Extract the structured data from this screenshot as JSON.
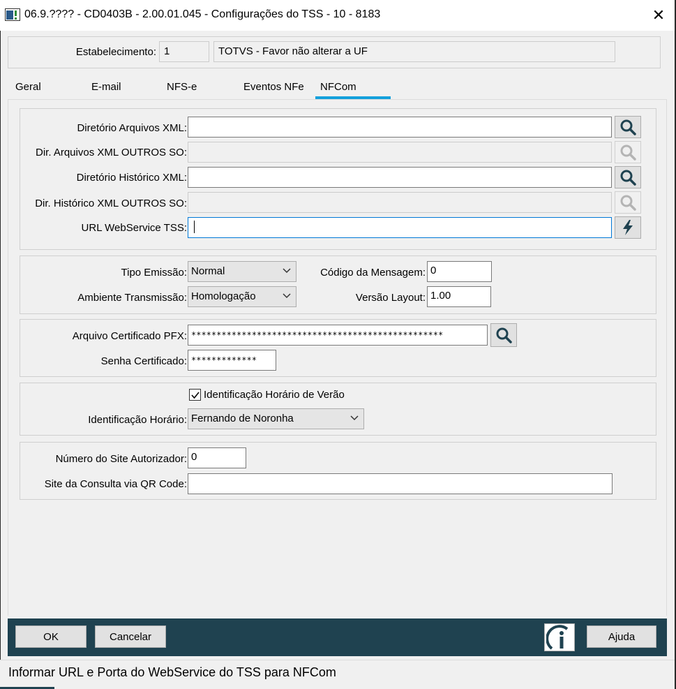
{
  "window": {
    "title": "06.9.???? - CD0403B - 2.00.01.045 - Configurações do TSS - 10 - 8183",
    "close_glyph": "✕"
  },
  "header": {
    "estabelecimento_label": "Estabelecimento:",
    "estabelecimento_code": "1",
    "estabelecimento_name": "TOTVS - Favor não alterar a UF"
  },
  "tabs": [
    {
      "label": "Geral",
      "selected": false
    },
    {
      "label": "E-mail",
      "selected": false
    },
    {
      "label": "NFS-e",
      "selected": false
    },
    {
      "label": "Eventos NFe",
      "selected": false
    },
    {
      "label": "NFCom",
      "selected": true
    }
  ],
  "directories": {
    "dir_xml_label": "Diretório Arquivos XML:",
    "dir_xml_value": "",
    "dir_xml_outros_label": "Dir. Arquivos XML OUTROS SO:",
    "dir_xml_outros_value": "",
    "dir_hist_label": "Diretório Histórico XML:",
    "dir_hist_value": "",
    "dir_hist_outros_label": "Dir. Histórico XML OUTROS SO:",
    "dir_hist_outros_value": "",
    "url_label": "URL WebService TSS:",
    "url_value": ""
  },
  "emission": {
    "tipo_label": "Tipo Emissão:",
    "tipo_value": "Normal",
    "ambiente_label": "Ambiente Transmissão:",
    "ambiente_value": "Homologação",
    "codigo_label": "Código da Mensagem:",
    "codigo_value": "0",
    "versao_label": "Versão Layout:",
    "versao_value": "1.00"
  },
  "certificate": {
    "arquivo_label": "Arquivo Certificado PFX:",
    "arquivo_value": "**************************************************",
    "senha_label": "Senha Certificado:",
    "senha_value": "*************"
  },
  "timezone": {
    "dst_label": "Identificação Horário de Verão",
    "dst_checked": true,
    "horario_label": "Identificação Horário:",
    "horario_value": "Fernando de Noronha"
  },
  "site": {
    "numero_label": "Número do Site Autorizador:",
    "numero_value": "0",
    "qr_label": "Site da Consulta via QR Code:",
    "qr_value": ""
  },
  "footer": {
    "ok_label": "OK",
    "cancel_label": "Cancelar",
    "help_label": "Ajuda"
  },
  "status": {
    "text": "Informar URL e Porta do WebService do TSS para NFCom"
  },
  "colors": {
    "footer_bar": "#1f4250",
    "tab_underline": "#14a0dc",
    "focus_border": "#0078d7",
    "search_icon": "#1f4250"
  },
  "icons": [
    "app-window-icon",
    "close-icon",
    "search-icon",
    "lightning-icon",
    "chevron-down-icon",
    "info-icon",
    "checkmark-icon"
  ]
}
